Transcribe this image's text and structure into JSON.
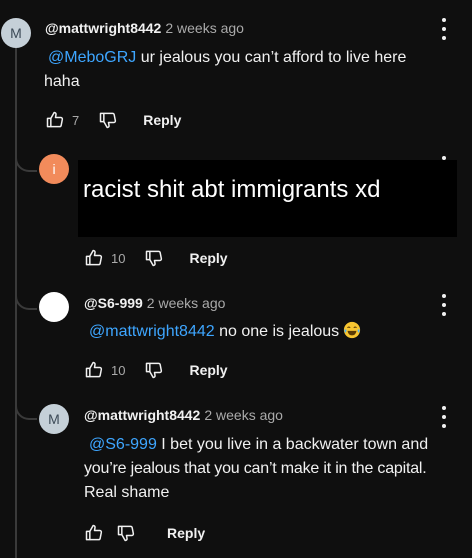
{
  "comments": [
    {
      "avatar_letter": "M",
      "avatar_color": "#c5d0d8",
      "handle": "@mattwright8442",
      "time": "2 weeks ago",
      "mention": "@MeboGRJ",
      "text_line1": " ur jealous you can’t afford to live here",
      "text_line2": "haha",
      "likes": "7",
      "reply_label": "Reply"
    },
    {
      "avatar_letter": "i",
      "avatar_color": "#f28b5b",
      "handle": "",
      "redaction_text": "racist shit abt immigrants xd",
      "likes": "10",
      "reply_label": "Reply"
    },
    {
      "avatar_letter": "",
      "avatar_color": "#ffffff",
      "handle": "@S6-999",
      "time": "2 weeks ago",
      "mention": "@mattwright8442",
      "text": " no one is jealous",
      "emoji": "laughing-tears",
      "likes": "10",
      "reply_label": "Reply"
    },
    {
      "avatar_letter": "M",
      "avatar_color": "#c5d0d8",
      "handle": "@mattwright8442",
      "time": "2 weeks ago",
      "mention": "@S6-999",
      "text_line1": " I bet you live in a backwater town and",
      "text_line2": "you’re jealous that you can’t make it in the capital.",
      "text_line3": "Real shame",
      "likes": "",
      "reply_label": "Reply"
    }
  ]
}
